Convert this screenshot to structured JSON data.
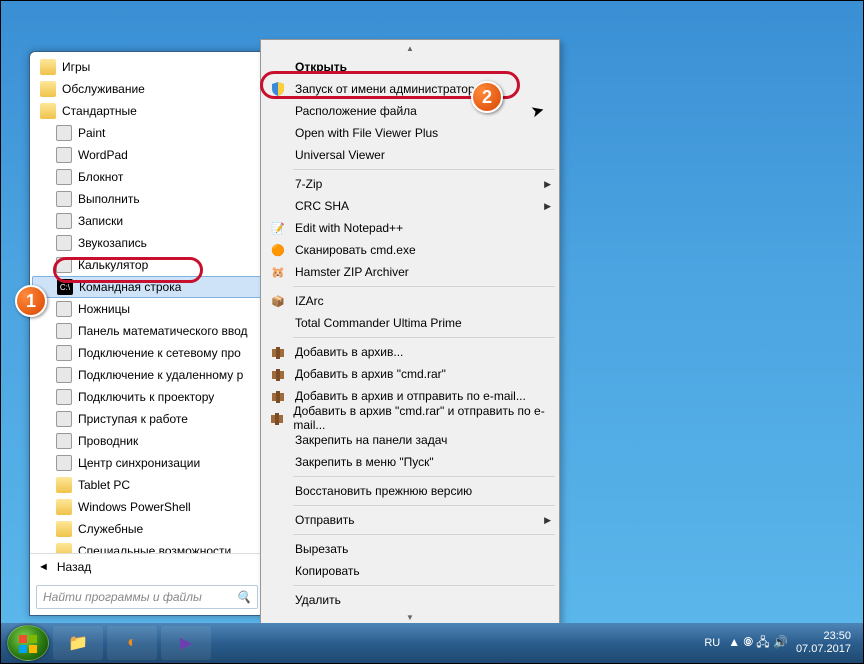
{
  "start_menu": {
    "items": [
      {
        "label": "Игры",
        "type": "folder",
        "level": 1
      },
      {
        "label": "Обслуживание",
        "type": "folder",
        "level": 1
      },
      {
        "label": "Стандартные",
        "type": "folder-open",
        "level": 1
      },
      {
        "label": "Paint",
        "type": "app",
        "level": 2,
        "icon": "paint"
      },
      {
        "label": "WordPad",
        "type": "app",
        "level": 2,
        "icon": "wordpad"
      },
      {
        "label": "Блокнот",
        "type": "app",
        "level": 2,
        "icon": "notepad"
      },
      {
        "label": "Выполнить",
        "type": "app",
        "level": 2,
        "icon": "run"
      },
      {
        "label": "Записки",
        "type": "app",
        "level": 2,
        "icon": "notes"
      },
      {
        "label": "Звукозапись",
        "type": "app",
        "level": 2,
        "icon": "sound"
      },
      {
        "label": "Калькулятор",
        "type": "app",
        "level": 2,
        "icon": "calc"
      },
      {
        "label": "Командная строка",
        "type": "app",
        "level": 2,
        "icon": "cmd",
        "highlighted": true
      },
      {
        "label": "Ножницы",
        "type": "app",
        "level": 2,
        "icon": "snip"
      },
      {
        "label": "Панель математического ввод",
        "type": "app",
        "level": 2,
        "icon": "math"
      },
      {
        "label": "Подключение к сетевому про",
        "type": "app",
        "level": 2,
        "icon": "netproj"
      },
      {
        "label": "Подключение к удаленному р",
        "type": "app",
        "level": 2,
        "icon": "rdp"
      },
      {
        "label": "Подключить к проектору",
        "type": "app",
        "level": 2,
        "icon": "proj"
      },
      {
        "label": "Приступая к работе",
        "type": "app",
        "level": 2,
        "icon": "start"
      },
      {
        "label": "Проводник",
        "type": "app",
        "level": 2,
        "icon": "explorer"
      },
      {
        "label": "Центр синхронизации",
        "type": "app",
        "level": 2,
        "icon": "sync"
      },
      {
        "label": "Tablet PC",
        "type": "folder",
        "level": 2
      },
      {
        "label": "Windows PowerShell",
        "type": "folder",
        "level": 2
      },
      {
        "label": "Служебные",
        "type": "folder",
        "level": 2
      },
      {
        "label": "Специальные возможности",
        "type": "folder",
        "level": 2
      }
    ],
    "back_label": "Назад",
    "search_placeholder": "Найти программы и файлы"
  },
  "context_menu": {
    "items": [
      {
        "label": "Открыть",
        "bold": true
      },
      {
        "label": "Запуск от имени администратора",
        "icon": "shield"
      },
      {
        "label": "Расположение файла"
      },
      {
        "label": "Open with File Viewer Plus"
      },
      {
        "label": "Universal Viewer"
      },
      {
        "sep": true
      },
      {
        "label": "7-Zip",
        "arrow": true
      },
      {
        "label": "CRC SHA",
        "arrow": true
      },
      {
        "label": "Edit with Notepad++",
        "icon": "npp"
      },
      {
        "label": "Сканировать cmd.exe",
        "icon": "avast"
      },
      {
        "label": "Hamster ZIP Archiver",
        "icon": "hamster"
      },
      {
        "sep": true
      },
      {
        "label": "IZArc",
        "icon": "izarc"
      },
      {
        "label": "Total Commander Ultima Prime"
      },
      {
        "sep": true
      },
      {
        "label": "Добавить в архив...",
        "icon": "winrar"
      },
      {
        "label": "Добавить в архив \"cmd.rar\"",
        "icon": "winrar"
      },
      {
        "label": "Добавить в архив и отправить по e-mail...",
        "icon": "winrar"
      },
      {
        "label": "Добавить в архив \"cmd.rar\" и отправить по e-mail...",
        "icon": "winrar"
      },
      {
        "label": "Закрепить на панели задач"
      },
      {
        "label": "Закрепить в меню \"Пуск\""
      },
      {
        "sep": true
      },
      {
        "label": "Восстановить прежнюю версию"
      },
      {
        "sep": true
      },
      {
        "label": "Отправить",
        "arrow": true
      },
      {
        "sep": true
      },
      {
        "label": "Вырезать"
      },
      {
        "label": "Копировать"
      },
      {
        "sep": true
      },
      {
        "label": "Удалить"
      }
    ]
  },
  "taskbar": {
    "lang": "RU",
    "time": "23:50",
    "date": "07.07.2017"
  },
  "badges": {
    "one": "1",
    "two": "2"
  }
}
